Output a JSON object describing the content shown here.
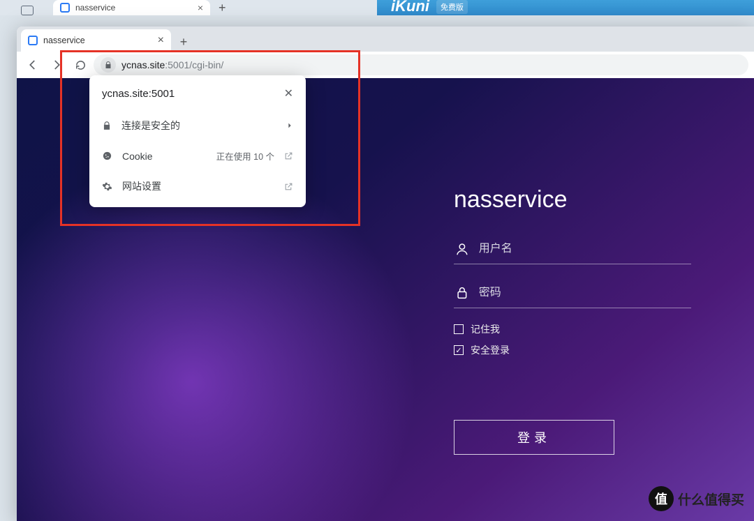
{
  "outer": {
    "tab_title": "nasservice"
  },
  "banner": {
    "logo": "iKuni",
    "tag": "免费版"
  },
  "browser": {
    "tab_title": "nasservice",
    "url_host": "ycnas.site",
    "url_rest": ":5001/cgi-bin/"
  },
  "popover": {
    "host": "ycnas.site:5001",
    "secure": "连接是安全的",
    "cookie_label": "Cookie",
    "cookie_status": "正在使用 10 个",
    "site_settings": "网站设置"
  },
  "login": {
    "title": "nasservice",
    "username_ph": "用户名",
    "password_ph": "密码",
    "remember": "记住我",
    "secure_login": "安全登录",
    "submit": "登录"
  },
  "watermark": {
    "badge": "值",
    "text": "什么值得买"
  }
}
